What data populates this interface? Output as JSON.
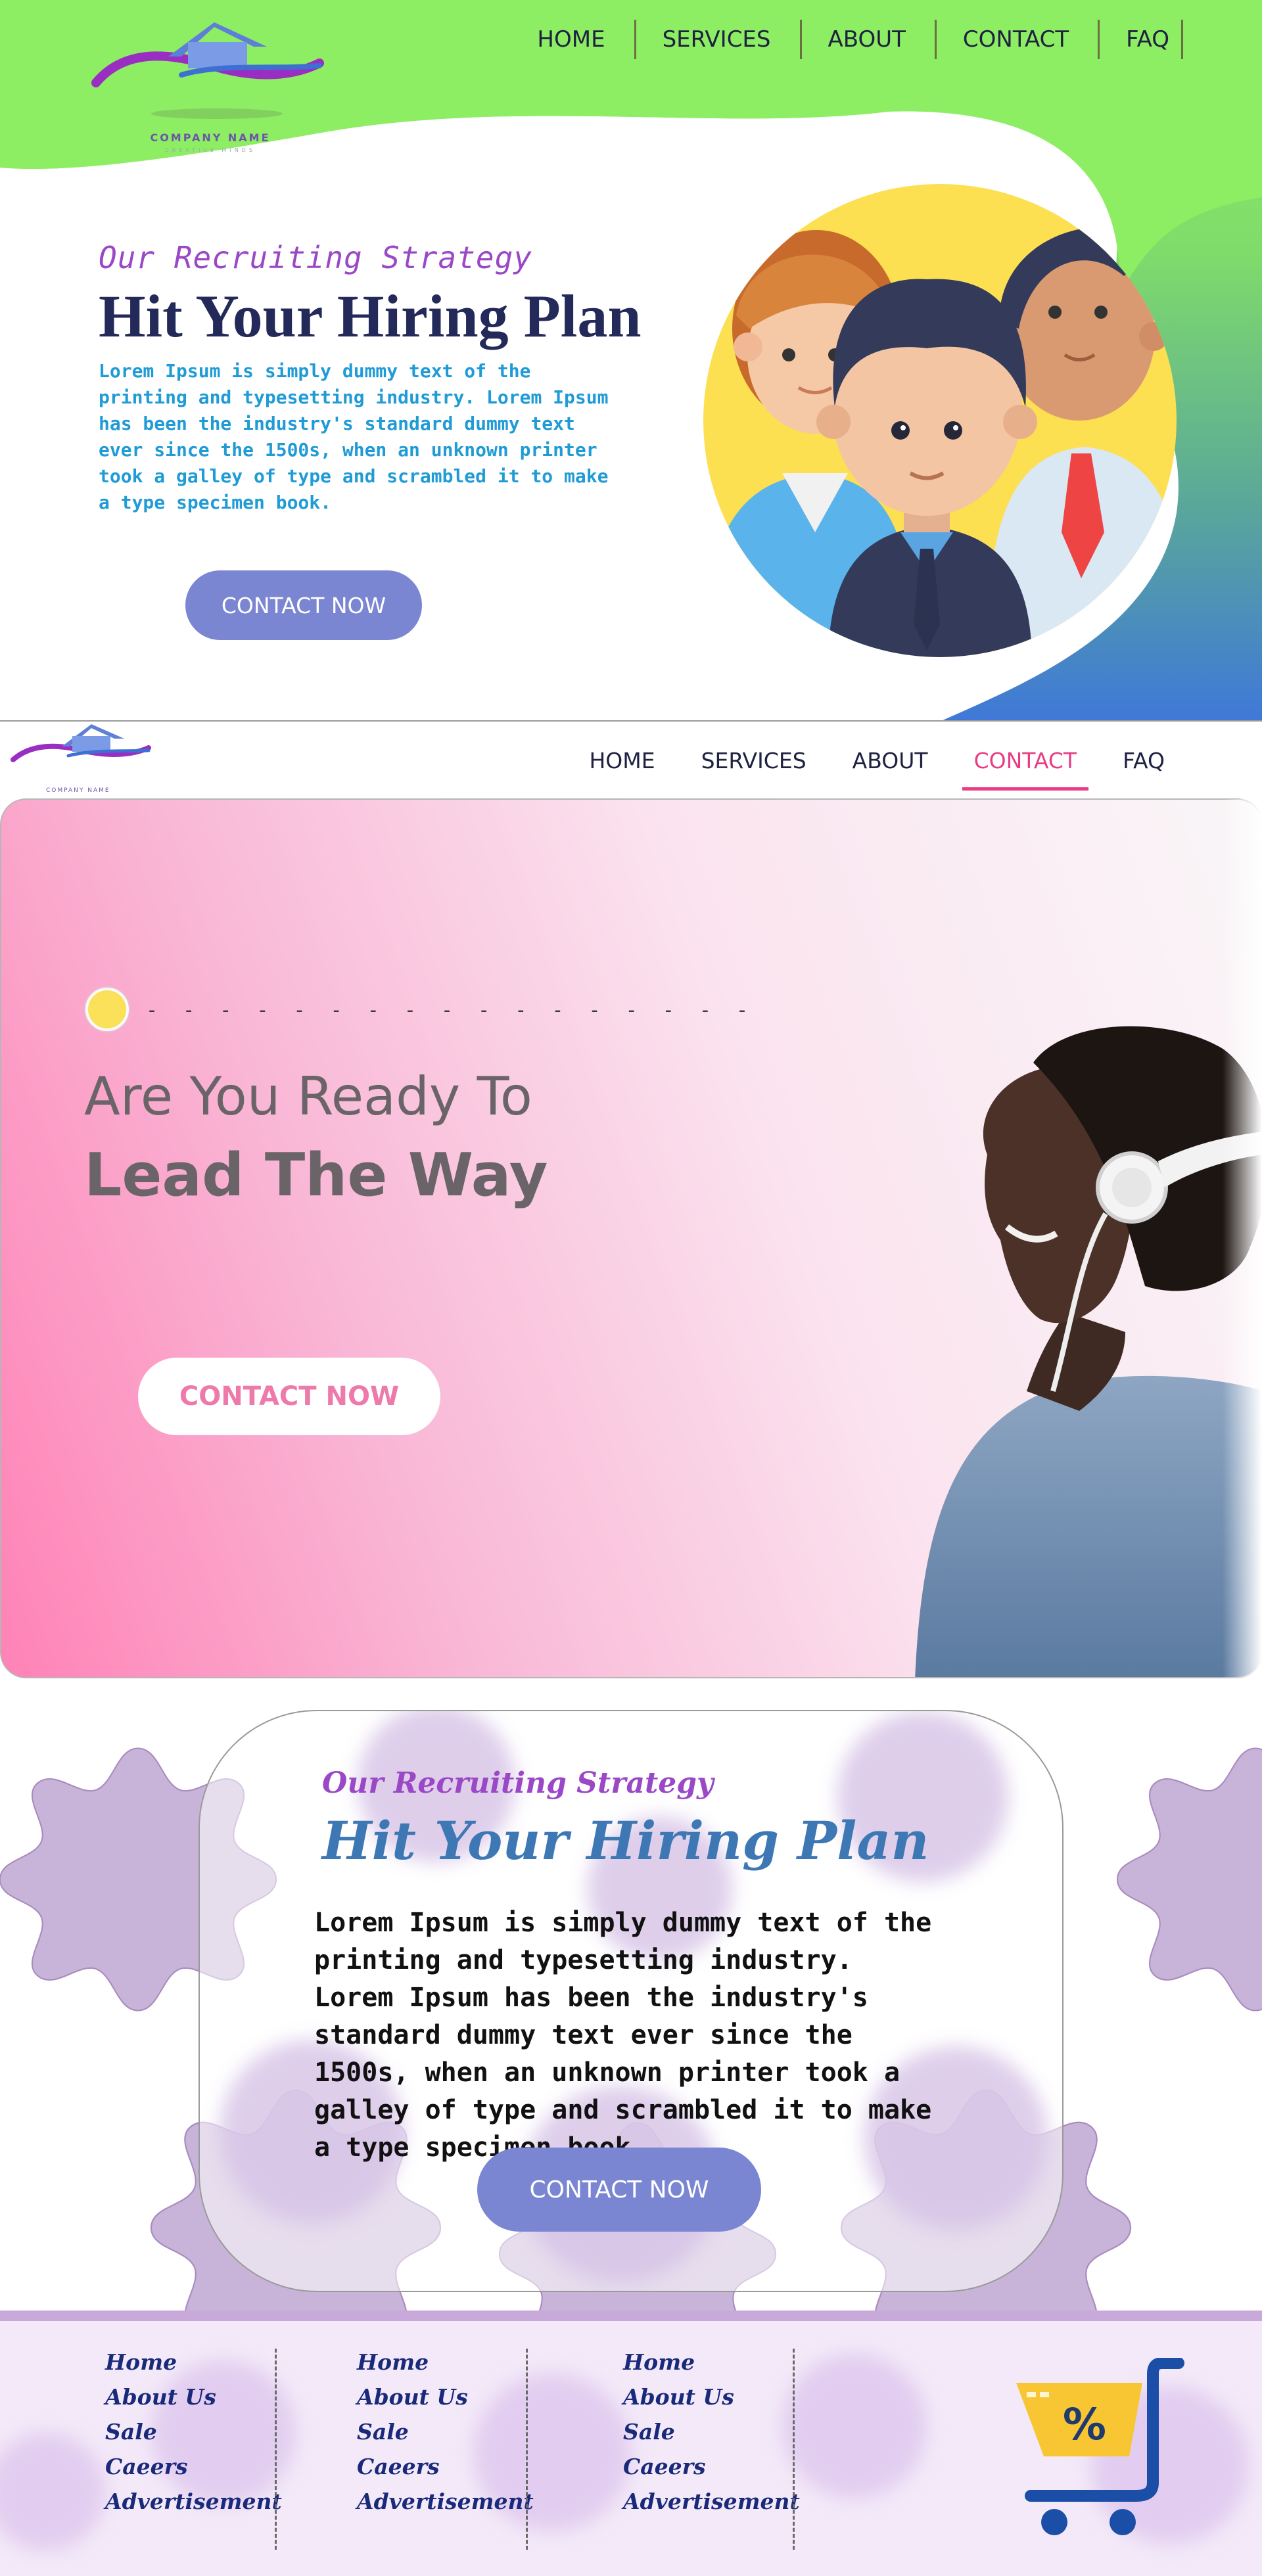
{
  "section1": {
    "company_name": "COMPANY NAME",
    "company_tagline": "CREATIVE MINDS",
    "nav": [
      "HOME",
      "SERVICES",
      "ABOUT",
      "CONTACT",
      "FAQ"
    ],
    "subtitle": "Our Recruiting Strategy",
    "title": "Hit Your Hiring Plan",
    "body": "Lorem Ipsum is simply dummy text of the printing and typesetting industry. Lorem Ipsum has been the industry's standard dummy text ever since the 1500s, when an unknown printer took a galley of type and scrambled it to make a type specimen book.",
    "cta": "CONTACT NOW"
  },
  "section2": {
    "company_name": "COMPANY NAME",
    "nav": [
      "HOME",
      "SERVICES",
      "ABOUT",
      "CONTACT",
      "FAQ"
    ],
    "active_nav": "CONTACT",
    "dashes": "- - - - - - - - - - - - - - - - -",
    "heading_line1": "Are You Ready To",
    "heading_line2": "Lead The Way",
    "cta": "CONTACT NOW"
  },
  "section3": {
    "subtitle": "Our Recruiting Strategy",
    "title": "Hit Your Hiring Plan",
    "body": "Lorem Ipsum is simply dummy text of the printing and typesetting industry. Lorem Ipsum has been the industry's standard dummy text ever since the 1500s, when an unknown printer took a galley of type and scrambled it to make a type specimen book.",
    "cta": "CONTACT NOW"
  },
  "footer": {
    "columns": [
      [
        "Home",
        "About Us",
        "Sale",
        "Caeers",
        "Advertisement"
      ],
      [
        "Home",
        "About Us",
        "Sale",
        "Caeers",
        "Advertisement"
      ],
      [
        "Home",
        "About Us",
        "Sale",
        "Caeers",
        "Advertisement"
      ]
    ],
    "cart_symbol": "%"
  },
  "colors": {
    "green_header": "#8ded63",
    "brand_purple": "#9a48c6",
    "button_blue": "#7b86d3",
    "accent_pink": "#e83d83",
    "title_navy": "#232a5a"
  },
  "icons": [
    "logo-house-icon",
    "people-illustration",
    "headphones-man-illustration",
    "gear-shape",
    "shopping-cart-icon"
  ]
}
